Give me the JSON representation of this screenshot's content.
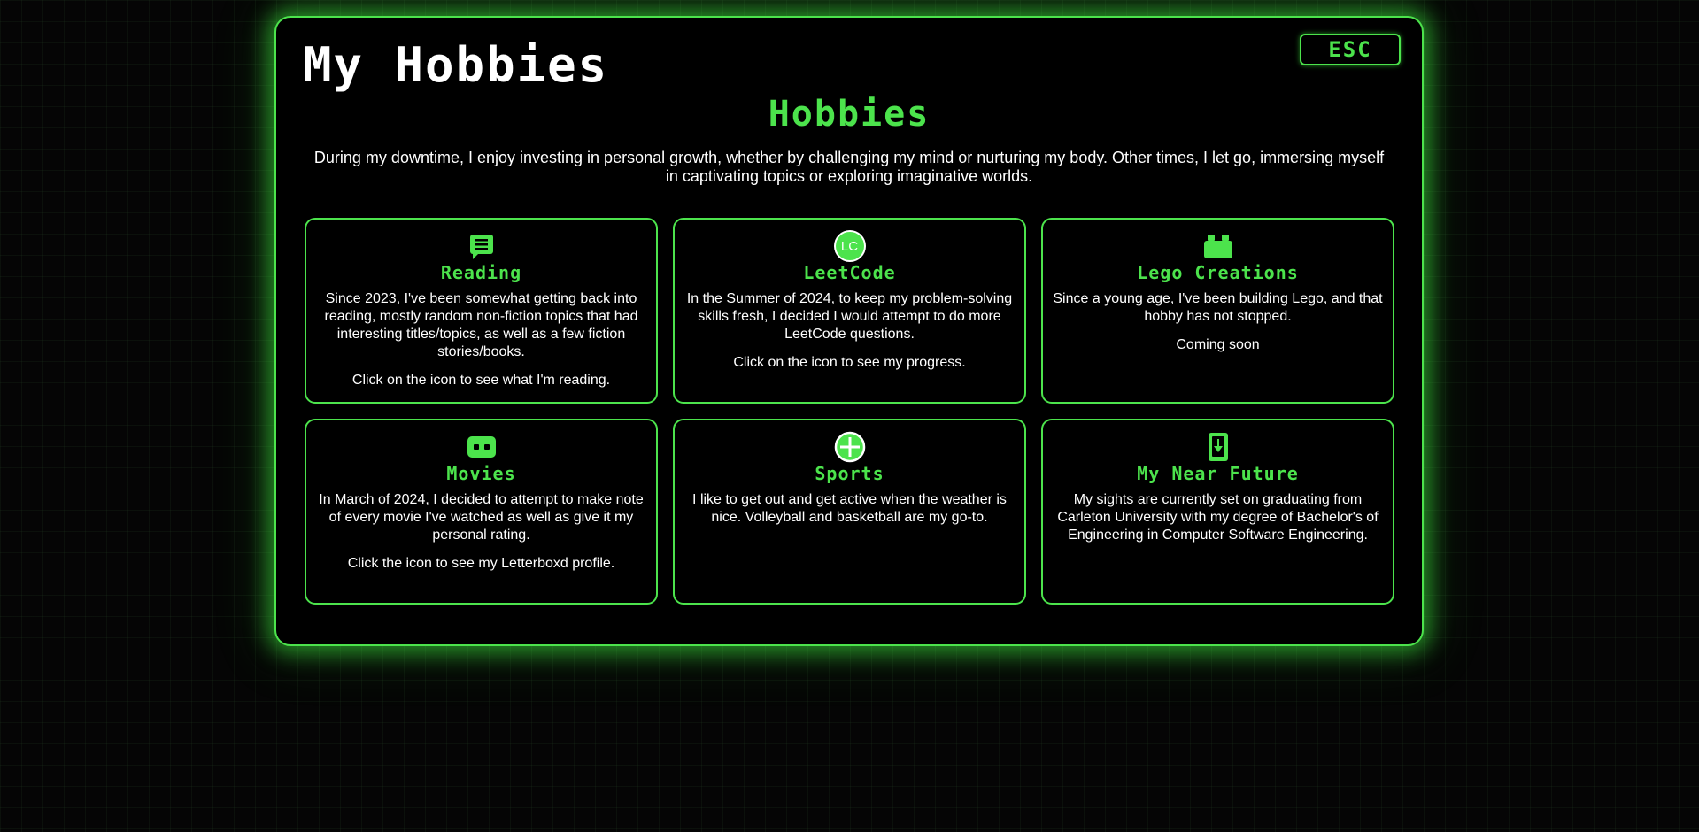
{
  "window": {
    "title": "My Hobbies",
    "esc_label": "ESC"
  },
  "heading": "Hobbies",
  "intro": "During my downtime, I enjoy investing in personal growth, whether by challenging my mind or nurturing my body. Other times, I let go, immersing myself in captivating topics or exploring imaginative worlds.",
  "colors": {
    "accent": "#4ce34c",
    "background": "#000000",
    "text": "#ffffff"
  },
  "cards": [
    {
      "icon": "book-chat-icon",
      "title": "Reading",
      "text": "Since 2023, I've been somewhat getting back into reading, mostly random non-fiction topics that had interesting titles/topics, as well as a few fiction stories/books.",
      "note": "Click on the icon to see what I'm reading."
    },
    {
      "icon": "leetcode-icon",
      "icon_text": "LC",
      "title": "LeetCode",
      "text": "In the Summer of 2024, to keep my problem-solving skills fresh, I decided I would attempt to do more LeetCode questions.",
      "note": "Click on the icon to see my progress."
    },
    {
      "icon": "lego-brick-icon",
      "title": "Lego Creations",
      "text": "Since a young age, I've been building Lego, and that hobby has not stopped.",
      "note": "Coming soon"
    },
    {
      "icon": "letterboxd-icon",
      "title": "Movies",
      "text": "In March of 2024, I decided to attempt to make note of every movie I've watched as well as give it my personal rating.",
      "note": "Click the icon to see my Letterboxd profile."
    },
    {
      "icon": "sports-ball-icon",
      "title": "Sports",
      "text": "I like to get out and get active when the weather is nice. Volleyball and basketball are my go-to.",
      "note": ""
    },
    {
      "icon": "phone-download-icon",
      "title": "My Near Future",
      "text": "My sights are currently set on graduating from Carleton University with my degree of Bachelor's of Engineering in Computer Software Engineering.",
      "note": ""
    }
  ]
}
